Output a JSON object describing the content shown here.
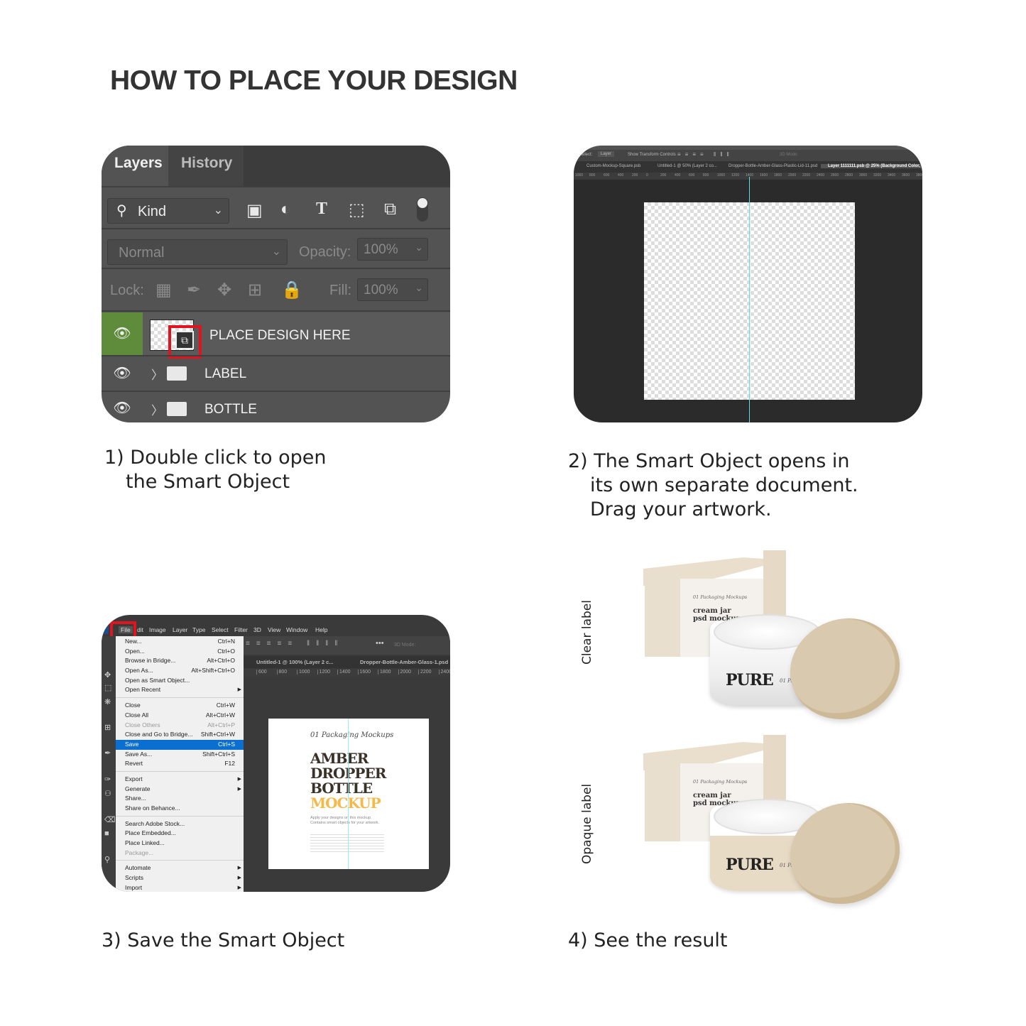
{
  "title": "HOW TO PLACE YOUR DESIGN",
  "colors": {
    "accent_red": "#e0141e",
    "layer_selected_green": "#5f8c3a",
    "menu_highlight": "#0a6fd1",
    "guide_cyan": "#5ee0e0",
    "mockup_amber": "#f5b94a"
  },
  "steps": [
    {
      "caption_line1": "1) Double click to open",
      "caption_line2": "the Smart Object"
    },
    {
      "caption_line1": "2) The Smart Object opens in",
      "caption_line2": "its own separate document.",
      "caption_line3": "Drag your artwork."
    },
    {
      "caption_line1": "3) Save the Smart Object"
    },
    {
      "caption_line1": "4) See the result"
    }
  ],
  "layers_panel": {
    "tabs": [
      {
        "label": "Layers",
        "active": true
      },
      {
        "label": "History",
        "active": false
      }
    ],
    "filter": {
      "label": "Kind",
      "icons": [
        "image-icon",
        "adjustment-icon",
        "type-icon",
        "shape-icon",
        "smart-object-icon",
        "toggle-icon"
      ]
    },
    "blend_mode": "Normal",
    "opacity_label": "Opacity:",
    "opacity_value": "100%",
    "lock_label": "Lock:",
    "fill_label": "Fill:",
    "fill_value": "100%",
    "layers": [
      {
        "name": "PLACE DESIGN HERE",
        "type": "smart-object",
        "selected": true
      },
      {
        "name": "LABEL",
        "type": "group"
      },
      {
        "name": "BOTTLE",
        "type": "group"
      }
    ]
  },
  "smart_object_doc": {
    "options": {
      "select_label": "Select:",
      "select_value": "Layer",
      "show_transform": "Show Transform Controls",
      "mode_3d": "3D Mode:"
    },
    "tabs": [
      "Custom-Mockup-Square.psb",
      "Untitled-1 @ 50% (Layer 2 co...",
      "Dropper-Bottle-Amber-Glass-Plastic-Lid-11.psd",
      "Layer 1111111.psb @ 25% (Background Color, RG"
    ],
    "ruler": [
      "1000",
      "800",
      "600",
      "400",
      "200",
      "0",
      "200",
      "400",
      "600",
      "800",
      "1000",
      "1200",
      "1400",
      "1600",
      "1800",
      "2000",
      "2200",
      "2400",
      "2600",
      "2800",
      "3000",
      "3200",
      "3400",
      "3600",
      "3800"
    ]
  },
  "save_screen": {
    "menubar": [
      "File",
      "dit",
      "Image",
      "Layer",
      "Type",
      "Select",
      "Filter",
      "3D",
      "View",
      "Window",
      "Help"
    ],
    "tabs": [
      "Untitled-1 @ 100% (Layer 2 c...",
      "Dropper-Bottle-Amber-Glass-1.psd"
    ],
    "ruler": [
      "600",
      "800",
      "1000",
      "1200",
      "1400",
      "1600",
      "1800",
      "2000",
      "2200",
      "2400"
    ],
    "mode_3d": "3D Mode:",
    "file_menu": [
      [
        {
          "label": "New...",
          "shortcut": "Ctrl+N"
        },
        {
          "label": "Open...",
          "shortcut": "Ctrl+O"
        },
        {
          "label": "Browse in Bridge...",
          "shortcut": "Alt+Ctrl+O"
        },
        {
          "label": "Open As...",
          "shortcut": "Alt+Shift+Ctrl+O"
        },
        {
          "label": "Open as Smart Object..."
        },
        {
          "label": "Open Recent",
          "submenu": true
        }
      ],
      [
        {
          "label": "Close",
          "shortcut": "Ctrl+W"
        },
        {
          "label": "Close All",
          "shortcut": "Alt+Ctrl+W"
        },
        {
          "label": "Close Others",
          "shortcut": "Alt+Ctrl+P",
          "disabled": true
        },
        {
          "label": "Close and Go to Bridge...",
          "shortcut": "Shift+Ctrl+W"
        },
        {
          "label": "Save",
          "shortcut": "Ctrl+S",
          "highlighted": true
        },
        {
          "label": "Save As...",
          "shortcut": "Shift+Ctrl+S"
        },
        {
          "label": "Revert",
          "shortcut": "F12"
        }
      ],
      [
        {
          "label": "Export",
          "submenu": true
        },
        {
          "label": "Generate",
          "submenu": true
        },
        {
          "label": "Share..."
        },
        {
          "label": "Share on Behance..."
        }
      ],
      [
        {
          "label": "Search Adobe Stock..."
        },
        {
          "label": "Place Embedded..."
        },
        {
          "label": "Place Linked..."
        },
        {
          "label": "Package...",
          "disabled": true
        }
      ],
      [
        {
          "label": "Automate",
          "submenu": true
        },
        {
          "label": "Scripts",
          "submenu": true
        },
        {
          "label": "Import",
          "submenu": true
        }
      ]
    ],
    "canvas": {
      "script": "01 Packaging Mockups",
      "headline": [
        "AMBER",
        "DROPPER",
        "BOTTLE"
      ],
      "headline_accent": "MOCKUP",
      "sub1": "Apply your designs on this mockup.",
      "sub2": "Contains smart objects for your artwork."
    }
  },
  "results": [
    {
      "label": "Clear label",
      "box_script": "01 Packaging Mockups",
      "box_title1": "cream jar",
      "box_title2": "psd mockup",
      "jar_brand": "PURE",
      "jar_script": "01 Packaging",
      "opaque": false
    },
    {
      "label": "Opaque label",
      "box_script": "01 Packaging Mockups",
      "box_title1": "cream jar",
      "box_title2": "psd mockup",
      "jar_brand": "PURE",
      "jar_script": "01 Packaging",
      "opaque": true
    }
  ]
}
